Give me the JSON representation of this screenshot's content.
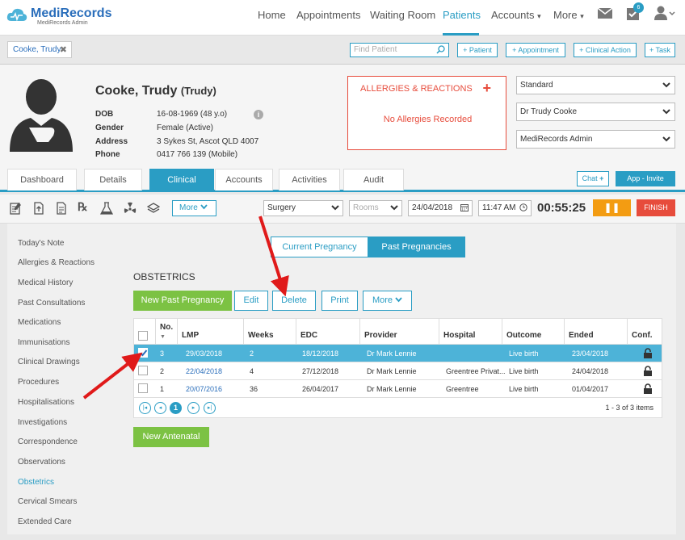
{
  "brand": {
    "name": "MediRecords",
    "sub": "MediRecords Admin"
  },
  "nav": {
    "items": [
      "Home",
      "Appointments",
      "Waiting Room",
      "Patients",
      "Accounts",
      "More"
    ],
    "notification_count": "6"
  },
  "tabbar": {
    "patient_tab": "Cooke, Trudy",
    "find_placeholder": "Find Patient",
    "buttons": [
      "+ Patient",
      "+ Appointment",
      "+ Clinical Action",
      "+ Task"
    ]
  },
  "patient": {
    "name": "Cooke, Trudy",
    "preferred": "(Trudy)",
    "labels": [
      "DOB",
      "Gender",
      "Address",
      "Phone"
    ],
    "values": [
      "16-08-1969 (48 y.o)",
      "Female (Active)",
      "3 Sykes St, Ascot QLD 4007",
      "0417 766 139 (Mobile)"
    ]
  },
  "allergies": {
    "title": "ALLERGIES & REACTIONS",
    "plus": "+",
    "none": "No Allergies Recorded"
  },
  "header_selects": [
    "Standard",
    "Dr Trudy Cooke",
    "MediRecords Admin"
  ],
  "main_tabs": [
    "Dashboard",
    "Details",
    "Clinical",
    "Accounts",
    "Activities",
    "Audit"
  ],
  "chat_label": "Chat",
  "invite_label": "App - Invite",
  "toolbar": {
    "more": "More",
    "location": "Surgery",
    "rooms": "Rooms",
    "date": "24/04/2018",
    "time": "11:47 AM",
    "timer": "00:55:25",
    "pause": "❚❚",
    "finish": "FINISH"
  },
  "sidebar": [
    "Today's Note",
    "Allergies & Reactions",
    "Medical History",
    "Past Consultations",
    "Medications",
    "Immunisations",
    "Clinical Drawings",
    "Procedures",
    "Hospitalisations",
    "Investigations",
    "Correspondence",
    "Observations",
    "Obstetrics",
    "Cervical Smears",
    "Extended Care"
  ],
  "segments": [
    "Current Pregnancy",
    "Past Pregnancies"
  ],
  "section_title": "OBSTETRICS",
  "actions": [
    "New Past Pregnancy",
    "Edit",
    "Delete",
    "Print",
    "More"
  ],
  "table": {
    "headers": [
      "No.",
      "LMP",
      "Weeks",
      "EDC",
      "Provider",
      "Hospital",
      "Outcome",
      "Ended",
      "Conf."
    ],
    "rows": [
      [
        "3",
        "29/03/2018",
        "2",
        "18/12/2018",
        "Dr Mark Lennie",
        "",
        "Live birth",
        "23/04/2018"
      ],
      [
        "2",
        "22/04/2018",
        "4",
        "27/12/2018",
        "Dr Mark Lennie",
        "Greentree Privat...",
        "Live birth",
        "24/04/2018"
      ],
      [
        "1",
        "20/07/2016",
        "36",
        "26/04/2017",
        "Dr Mark Lennie",
        "Greentree",
        "Live birth",
        "01/04/2017"
      ]
    ],
    "pager": [
      "|◂",
      "◂",
      "1",
      "▸",
      "▸|"
    ],
    "pager_info": "1 - 3 of 3 items"
  },
  "new_antenatal": "New Antenatal",
  "colors": {
    "accent": "#2a9dc4",
    "green": "#7cc243",
    "red": "#e74c3c",
    "orange": "#f39c12"
  }
}
